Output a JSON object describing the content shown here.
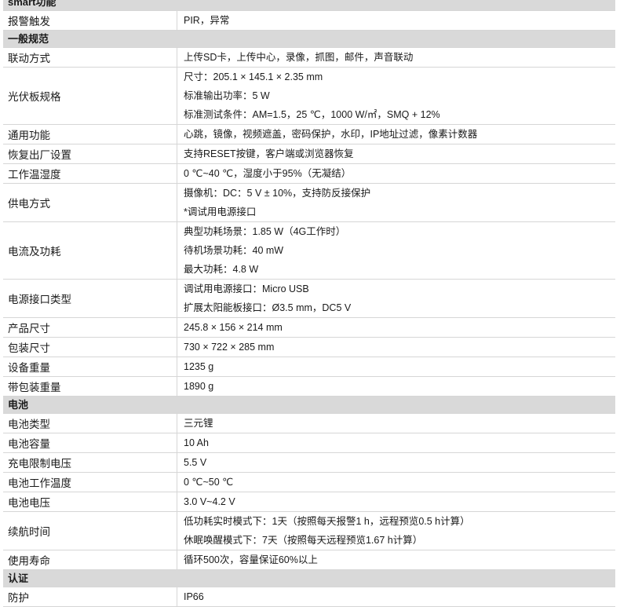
{
  "sections": [
    {
      "title": "smart功能",
      "rows": [
        {
          "key": "报警触发",
          "lines": [
            "PIR，异常"
          ]
        }
      ]
    },
    {
      "title": "一般规范",
      "rows": [
        {
          "key": "联动方式",
          "lines": [
            "上传SD卡，上传中心，录像，抓图，邮件，声音联动"
          ]
        },
        {
          "key": "光伏板规格",
          "lines": [
            "尺寸：205.1 × 145.1 × 2.35 mm",
            "标准输出功率：5 W",
            "标准测试条件：AM=1.5，25 ℃，1000 W/㎡，SMQ + 12%"
          ]
        },
        {
          "key": "通用功能",
          "lines": [
            "心跳，镜像，视频遮盖，密码保护，水印，IP地址过滤，像素计数器"
          ]
        },
        {
          "key": "恢复出厂设置",
          "lines": [
            "支持RESET按键，客户端或浏览器恢复"
          ]
        },
        {
          "key": "工作温湿度",
          "lines": [
            "0 ℃~40 ℃，湿度小于95%（无凝结）"
          ]
        },
        {
          "key": "供电方式",
          "lines": [
            "摄像机：DC：5 V ± 10%，支持防反接保护",
            "*调试用电源接口"
          ]
        },
        {
          "key": "电流及功耗",
          "lines": [
            "典型功耗场景：1.85 W（4G工作时）",
            "待机场景功耗：40 mW",
            "最大功耗：4.8 W"
          ]
        },
        {
          "key": "电源接口类型",
          "lines": [
            "调试用电源接口：Micro USB",
            "扩展太阳能板接口：Ø3.5 mm，DC5 V"
          ]
        },
        {
          "key": "产品尺寸",
          "lines": [
            "245.8 × 156 × 214 mm"
          ]
        },
        {
          "key": "包装尺寸",
          "lines": [
            "730 × 722 × 285 mm"
          ]
        },
        {
          "key": "设备重量",
          "lines": [
            "1235 g"
          ]
        },
        {
          "key": "带包装重量",
          "lines": [
            "1890 g"
          ]
        }
      ]
    },
    {
      "title": "电池",
      "rows": [
        {
          "key": "电池类型",
          "lines": [
            "三元锂"
          ]
        },
        {
          "key": "电池容量",
          "lines": [
            "10 Ah"
          ]
        },
        {
          "key": "充电限制电压",
          "lines": [
            "5.5 V"
          ]
        },
        {
          "key": "电池工作温度",
          "lines": [
            "0 ℃~50 ℃"
          ]
        },
        {
          "key": "电池电压",
          "lines": [
            "3.0 V~4.2 V"
          ]
        },
        {
          "key": "续航时间",
          "lines": [
            "低功耗实时模式下：1天（按照每天报警1 h，远程预览0.5 h计算）",
            "休眠唤醒模式下：7天（按照每天远程预览1.67 h计算）"
          ]
        },
        {
          "key": "使用寿命",
          "lines": [
            "循环500次，容量保证60%以上"
          ]
        }
      ]
    },
    {
      "title": "认证",
      "rows": [
        {
          "key": "防护",
          "lines": [
            "IP66"
          ]
        }
      ]
    }
  ]
}
